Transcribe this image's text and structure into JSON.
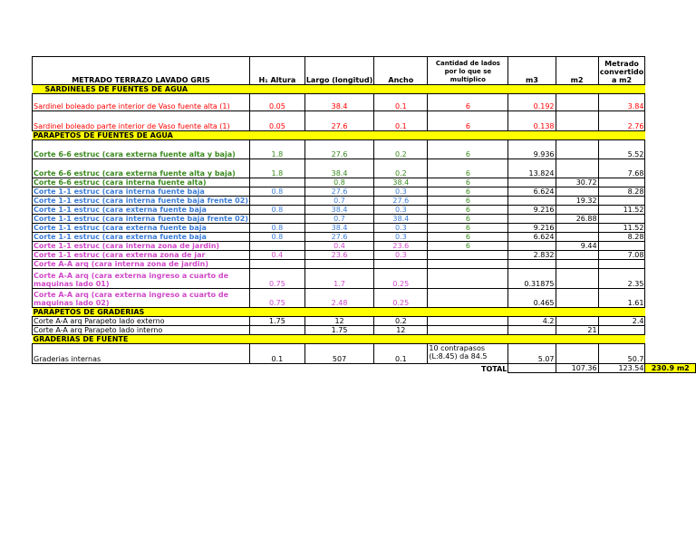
{
  "headers": [
    "METRADO TERRAZO LAVADO GRIS",
    "H₁ Altura",
    "Largo (longitud)",
    "Ancho",
    "Cantidad de lados por lo que se multiplico",
    "m3",
    "m2",
    "Metrado convertido a m2"
  ],
  "sections": {
    "s1": "SARDINELES DE FUENTES DE AGUA",
    "s2": "PARAPETOS DE FUENTES DE AGUA",
    "s3": "PARAPETOS DE GRADERIAS",
    "s4": "GRADERIAS DE FUENTE"
  },
  "rows": [
    [
      "Sardinel boleado parte interior de Vaso fuente alta (1)",
      "0.05",
      "38.4",
      "0.1",
      "6",
      "0.192",
      "",
      "3.84"
    ],
    [
      "Sardinel boleado parte interior de Vaso fuente alta (1)",
      "0.05",
      "27.6",
      "0.1",
      "6",
      "0.138",
      "",
      "2.76"
    ],
    [
      "Corte 6-6 estruc (cara externa fuente alta y baja)",
      "1.8",
      "27.6",
      "0.2",
      "6",
      "9.936",
      "",
      "5.52"
    ],
    [
      "Corte 6-6 estruc (cara externa fuente alta y baja)",
      "1.8",
      "38.4",
      "0.2",
      "6",
      "13.824",
      "",
      "7.68"
    ],
    [
      "Corte 6-6 estruc (cara interna fuente alta)",
      "",
      "0.8",
      "38.4",
      "6",
      "",
      "30.72",
      ""
    ],
    [
      "Corte 1-1 estruc (cara interna fuente baja",
      "0.8",
      "27.6",
      "0.3",
      "6",
      "6.624",
      "",
      "8.28"
    ],
    [
      "Corte 1-1 estruc (cara interna fuente baja frente 02)",
      "",
      "0.7",
      "27.6",
      "6",
      "",
      "19.32",
      ""
    ],
    [
      "Corte 1-1 estruc (cara externa fuente baja",
      "0.8",
      "38.4",
      "0.3",
      "6",
      "9.216",
      "",
      "11.52"
    ],
    [
      "Corte 1-1 estruc (cara interna fuente baja frente 02)",
      "",
      "0.7",
      "38.4",
      "6",
      "",
      "26.88",
      ""
    ],
    [
      "Corte 1-1 estruc (cara externa fuente baja",
      "0.8",
      "38.4",
      "0.3",
      "6",
      "9.216",
      "",
      "11.52"
    ],
    [
      "Corte 1-1 estruc (cara externa fuente baja",
      "0.8",
      "27.6",
      "0.3",
      "6",
      "6.624",
      "",
      "8.28"
    ],
    [
      "Corte 1-1 estruc (cara interna zona de jardin)",
      "",
      "0.4",
      "23.6",
      "6",
      "",
      "9.44",
      ""
    ],
    [
      "Corte 1-1 estruc (cara externa zona de jar",
      "0.4",
      "23.6",
      "0.3",
      "",
      "2.832",
      "",
      "7.08"
    ],
    [
      "Corte A-A arq (cara interna zona de jardin)",
      "",
      "",
      "",
      "",
      "",
      "",
      ""
    ],
    [
      "Corte A-A arq (cara externa ingreso a cuarto de maquinas lado 01)",
      "0.75",
      "1.7",
      "0.25",
      "",
      "0.31875",
      "",
      "2.35"
    ],
    [
      "Corte A-A arq (cara externa ingreso a cuarto de maquinas lado 02)",
      "0.75",
      "2.48",
      "0.25",
      "",
      "0.465",
      "",
      "1.61"
    ],
    [
      "Corte A-A arq Parapeto lado externo",
      "1.75",
      "12",
      "0.2",
      "",
      "4.2",
      "",
      "2.4"
    ],
    [
      "Corte A-A arq Parapeto lado interno",
      "",
      "1.75",
      "12",
      "",
      "",
      "21",
      ""
    ],
    [
      "Graderias internas",
      "0.1",
      "507",
      "0.1",
      "10 contrapasos (L:8.45) da 84.5",
      "5.07",
      "",
      "50.7"
    ]
  ],
  "total": {
    "label": "TOTAL",
    "m2": "107.36",
    "converted": "123.54",
    "grand": "230.9 m2"
  },
  "colors": {
    "section_bg": "#ffff00",
    "red": "#ff0000",
    "green": "#3a8a1e",
    "blue": "#3b7dd8",
    "pink": "#d048c8"
  }
}
